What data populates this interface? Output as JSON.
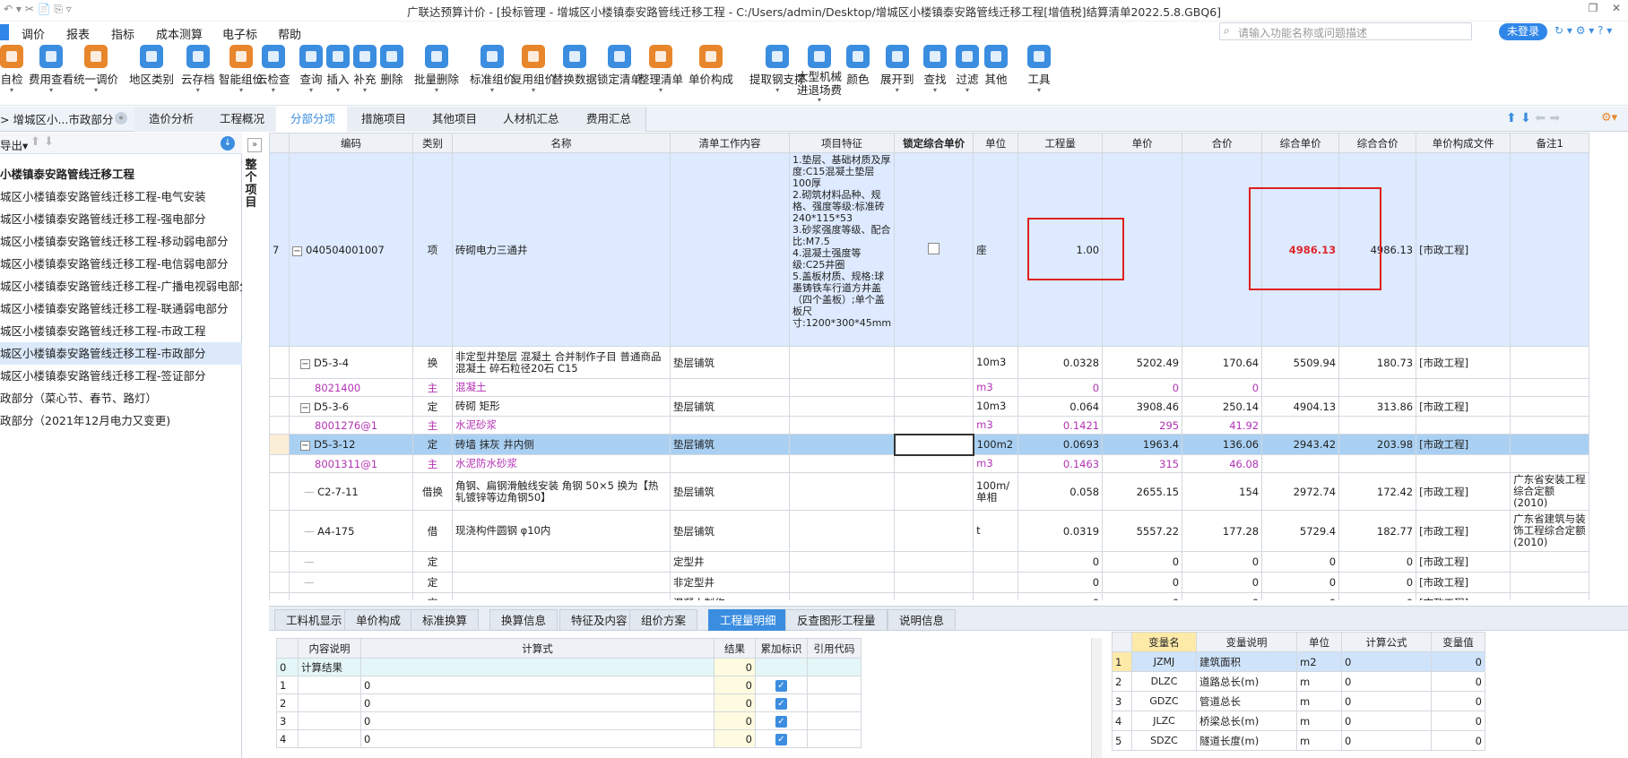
{
  "app": {
    "title": "广联达预算计价 - [投标管理 - 增城区小楼镇泰安路管线迁移工程 - C:/Users/admin/Desktop/增城区小楼镇泰安路管线迁移工程[增值税]结算清单2022.5.8.GBQ6]"
  },
  "menu": [
    "调价",
    "报表",
    "指标",
    "成本测算",
    "电子标",
    "帮助"
  ],
  "search": {
    "placeholder": "请输入功能名称或问题描述"
  },
  "login": "未登录",
  "ribbon": [
    {
      "label": "自检",
      "color": "#e8862b"
    },
    {
      "label": "费用查看",
      "color": "#3b8de0"
    },
    {
      "label": "统一调价",
      "color": "#e8862b"
    },
    {
      "label": "地区类别",
      "color": "#3b8de0"
    },
    {
      "label": "云存档",
      "color": "#3b8de0"
    },
    {
      "label": "智能组价",
      "color": "#e8862b"
    },
    {
      "label": "云检查",
      "color": "#3b8de0"
    },
    {
      "label": "查询",
      "color": "#3b8de0"
    },
    {
      "label": "插入",
      "color": "#3b8de0"
    },
    {
      "label": "补充",
      "color": "#3b8de0"
    },
    {
      "label": "删除",
      "color": "#3b8de0"
    },
    {
      "label": "批量删除",
      "color": "#3b8de0"
    },
    {
      "label": "标准组价",
      "color": "#3b8de0"
    },
    {
      "label": "复用组价",
      "color": "#e8862b"
    },
    {
      "label": "替换数据",
      "color": "#3b8de0"
    },
    {
      "label": "锁定清单",
      "color": "#3b8de0"
    },
    {
      "label": "整理清单",
      "color": "#e8862b"
    },
    {
      "label": "单价构成",
      "color": "#e8862b"
    },
    {
      "label": "提取钢支撑",
      "color": "#3b8de0"
    },
    {
      "label": "大型机械进退场费",
      "color": "#3b8de0"
    },
    {
      "label": "颜色",
      "color": "#3b8de0"
    },
    {
      "label": "展开到",
      "color": "#3b8de0"
    },
    {
      "label": "查找",
      "color": "#3b8de0"
    },
    {
      "label": "过滤",
      "color": "#3b8de0"
    },
    {
      "label": "其他",
      "color": "#3b8de0"
    },
    {
      "label": "工具",
      "color": "#3b8de0"
    }
  ],
  "breadcrumb": "> 增城区小...市政部分",
  "tabs": [
    "造价分析",
    "工程概况",
    "分部分项",
    "措施项目",
    "其他项目",
    "人材机汇总",
    "费用汇总"
  ],
  "sidebar": {
    "export": "导出",
    "items": [
      "小楼镇泰安路管线迁移工程",
      "城区小楼镇泰安路管线迁移工程-电气安装",
      "城区小楼镇泰安路管线迁移工程-强电部分",
      "城区小楼镇泰安路管线迁移工程-移动弱电部分",
      "城区小楼镇泰安路管线迁移工程-电信弱电部分",
      "城区小楼镇泰安路管线迁移工程-广播电视弱电部分",
      "城区小楼镇泰安路管线迁移工程-联通弱电部分",
      "城区小楼镇泰安路管线迁移工程-市政工程",
      "城区小楼镇泰安路管线迁移工程-市政部分",
      "城区小楼镇泰安路管线迁移工程-签证部分",
      "政部分（菜心节、春节、路灯）",
      "政部分（2021年12月电力又变更)"
    ]
  },
  "vertical_label": "整个项目",
  "grid": {
    "headers": [
      "编码",
      "类别",
      "名称",
      "清单工作内容",
      "项目特征",
      "锁定综合单价",
      "单位",
      "工程量",
      "单价",
      "合价",
      "综合单价",
      "综合合价",
      "单价构成文件",
      "备注1"
    ],
    "main": {
      "num": "7",
      "code": "040504001007",
      "type": "项",
      "name": "砖砌电力三通井",
      "feature": "1.垫层、基础材质及厚度:C15混凝土垫层100厚\n2.砌筑材料品种、规格、强度等级:标准砖240*115*53\n3.砂浆强度等级、配合比:M7.5\n4.混凝土强度等级:C25井圈\n5.盖板材质、规格:球墨铸铁车行道方井盖（四个盖板）;单个盖板尺寸:1200*300*45mm",
      "unit": "座",
      "qty": "1.00",
      "zhdj": "4986.13",
      "zhhj": "4986.13",
      "file": "[市政工程]"
    },
    "rows": [
      {
        "code": "D5-3-4",
        "type": "换",
        "name": "非定型井垫层 混凝土 合并制作子目 普通商品混凝土 碎石粒径20石 C15",
        "work": "垫层铺筑",
        "unit": "10m3",
        "qty": "0.0328",
        "dj": "5202.49",
        "hj": "170.64",
        "zhdj": "5509.94",
        "zhhj": "180.73",
        "file": "[市政工程]",
        "note": "",
        "style": "parent"
      },
      {
        "code": "8021400",
        "type": "主",
        "name": "混凝土",
        "work": "",
        "unit": "m3",
        "qty": "0",
        "dj": "0",
        "hj": "0",
        "zhdj": "",
        "zhhj": "",
        "file": "",
        "note": "",
        "style": "purple"
      },
      {
        "code": "D5-3-6",
        "type": "定",
        "name": "砖砌 矩形",
        "work": "垫层铺筑",
        "unit": "10m3",
        "qty": "0.064",
        "dj": "3908.46",
        "hj": "250.14",
        "zhdj": "4904.13",
        "zhhj": "313.86",
        "file": "[市政工程]",
        "note": "",
        "style": "parent"
      },
      {
        "code": "8001276@1",
        "type": "主",
        "name": "水泥砂浆",
        "work": "",
        "unit": "m3",
        "qty": "0.1421",
        "dj": "295",
        "hj": "41.92",
        "zhdj": "",
        "zhhj": "",
        "file": "",
        "note": "",
        "style": "purple"
      },
      {
        "code": "D5-3-12",
        "type": "定",
        "name": "砖墙 抹灰 井内侧",
        "work": "垫层铺筑",
        "unit": "100m2",
        "qty": "0.0693",
        "dj": "1963.4",
        "hj": "136.06",
        "zhdj": "2943.42",
        "zhhj": "203.98",
        "file": "[市政工程]",
        "note": "",
        "style": "selected"
      },
      {
        "code": "8001311@1",
        "type": "主",
        "name": "水泥防水砂浆",
        "work": "",
        "unit": "m3",
        "qty": "0.1463",
        "dj": "315",
        "hj": "46.08",
        "zhdj": "",
        "zhhj": "",
        "file": "",
        "note": "",
        "style": "purple"
      },
      {
        "code": "C2-7-11",
        "type": "借换",
        "name": "角钢、扁钢滑触线安装 角钢 50×5 换为【热轧镀锌等边角钢50】",
        "work": "垫层铺筑",
        "unit": "100m/单相",
        "qty": "0.058",
        "dj": "2655.15",
        "hj": "154",
        "zhdj": "2972.74",
        "zhhj": "172.42",
        "file": "[市政工程]",
        "note": "广东省安装工程综合定额(2010)",
        "style": "tall"
      },
      {
        "code": "A4-175",
        "type": "借",
        "name": "现浇构件圆钢 φ10内",
        "work": "垫层铺筑",
        "unit": "t",
        "qty": "0.0319",
        "dj": "5557.22",
        "hj": "177.28",
        "zhdj": "5729.4",
        "zhhj": "182.77",
        "file": "[市政工程]",
        "note": "广东省建筑与装饰工程综合定额(2010)",
        "style": "tall"
      },
      {
        "code": "",
        "type": "定",
        "name": "",
        "work": "定型井",
        "unit": "",
        "qty": "0",
        "dj": "0",
        "hj": "0",
        "zhdj": "0",
        "zhhj": "0",
        "file": "[市政工程]",
        "note": "",
        "style": "plain"
      },
      {
        "code": "",
        "type": "定",
        "name": "",
        "work": "非定型井",
        "unit": "",
        "qty": "0",
        "dj": "0",
        "hj": "0",
        "zhdj": "0",
        "zhhj": "0",
        "file": "[市政工程]",
        "note": "",
        "style": "plain"
      },
      {
        "code": "",
        "type": "定",
        "name": "",
        "work": "混凝土制作",
        "unit": "",
        "qty": "0",
        "dj": "0",
        "hj": "0",
        "zhdj": "0",
        "zhhj": "0",
        "file": "[市政工程]",
        "note": "",
        "style": "plain"
      }
    ]
  },
  "bottom_tabs": [
    "工料机显示",
    "单价构成",
    "标准换算",
    "换算信息",
    "特征及内容",
    "组价方案",
    "工程量明细",
    "反查图形工程量",
    "说明信息"
  ],
  "calc": {
    "headers": [
      "内容说明",
      "计算式",
      "结果",
      "累加标识",
      "引用代码"
    ],
    "rows": [
      {
        "n": "0",
        "desc": "计算结果",
        "expr": "",
        "res": "0",
        "chk": ""
      },
      {
        "n": "1",
        "desc": "",
        "expr": "0",
        "res": "0",
        "chk": "✓"
      },
      {
        "n": "2",
        "desc": "",
        "expr": "0",
        "res": "0",
        "chk": "✓"
      },
      {
        "n": "3",
        "desc": "",
        "expr": "0",
        "res": "0",
        "chk": "✓"
      },
      {
        "n": "4",
        "desc": "",
        "expr": "0",
        "res": "0",
        "chk": "✓"
      }
    ]
  },
  "vars": {
    "headers": [
      "变量名",
      "变量说明",
      "单位",
      "计算公式",
      "变量值"
    ],
    "rows": [
      {
        "n": "1",
        "name": "JZMJ",
        "desc": "建筑面积",
        "unit": "m2",
        "formula": "0",
        "val": "0"
      },
      {
        "n": "2",
        "name": "DLZC",
        "desc": "道路总长(m)",
        "unit": "m",
        "formula": "0",
        "val": "0"
      },
      {
        "n": "3",
        "name": "GDZC",
        "desc": "管道总长",
        "unit": "m",
        "formula": "0",
        "val": "0"
      },
      {
        "n": "4",
        "name": "JLZC",
        "desc": "桥梁总长(m)",
        "unit": "m",
        "formula": "0",
        "val": "0"
      },
      {
        "n": "5",
        "name": "SDZC",
        "desc": "隧道长度(m)",
        "unit": "m",
        "formula": "0",
        "val": "0"
      }
    ]
  }
}
